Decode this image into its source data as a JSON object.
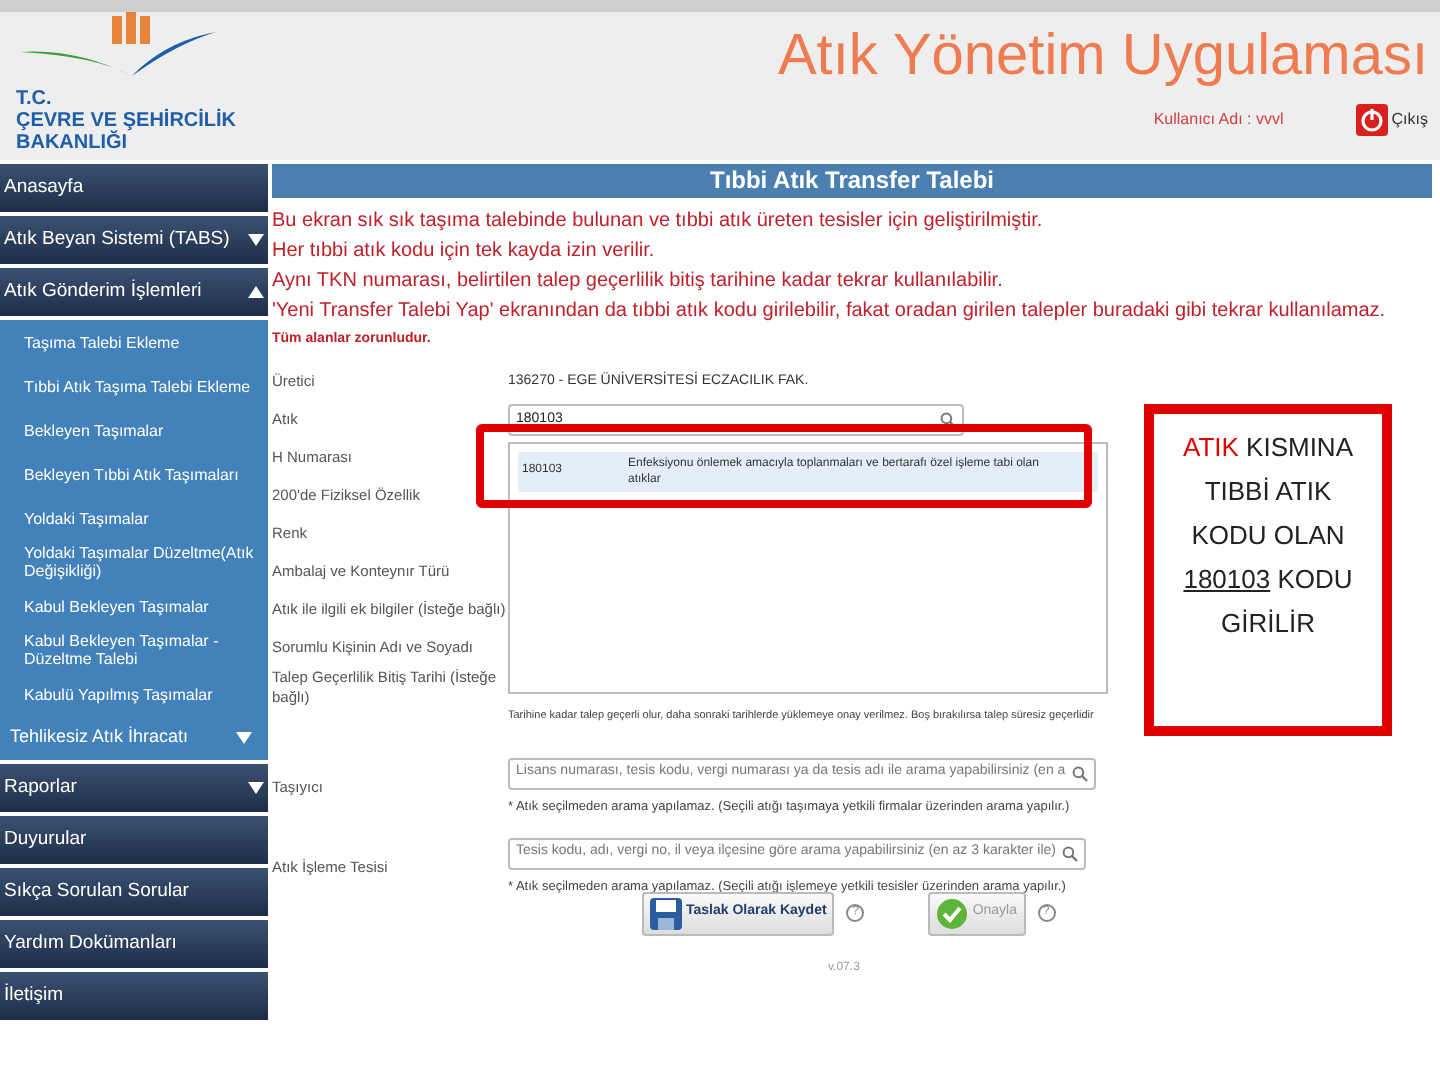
{
  "header": {
    "ministry_lines": [
      "T.C.",
      "ÇEVRE VE ŞEHİRCİLİK",
      "BAKANLIĞI"
    ],
    "app_title": "Atık Yönetim Uygulaması",
    "user_label": "Kullanıcı Adı : vvvl",
    "logout": "Çıkış"
  },
  "sidebar": {
    "items": [
      {
        "label": "Anasayfa",
        "kind": "main"
      },
      {
        "label": "Atık Beyan Sistemi (TABS)",
        "kind": "main",
        "expanded": false
      },
      {
        "label": "Atık Gönderim İşlemleri",
        "kind": "main",
        "expanded": true
      },
      {
        "label": "Taşıma Talebi Ekleme",
        "kind": "sub"
      },
      {
        "label": "Tıbbi Atık Taşıma Talebi Ekleme",
        "kind": "sub"
      },
      {
        "label": "Bekleyen Taşımalar",
        "kind": "sub"
      },
      {
        "label": "Bekleyen Tıbbi Atık Taşımaları",
        "kind": "sub"
      },
      {
        "label": "Yoldaki Taşımalar",
        "kind": "sub"
      },
      {
        "label": "Yoldaki Taşımalar Düzeltme(Atık Değişikliği)",
        "kind": "sub"
      },
      {
        "label": "Kabul Bekleyen Taşımalar",
        "kind": "sub"
      },
      {
        "label": "Kabul Bekleyen Taşımalar - Düzeltme Talebi",
        "kind": "sub"
      },
      {
        "label": "Kabulü Yapılmış Taşımalar",
        "kind": "sub"
      },
      {
        "label": "Tehlikesiz Atık İhracatı",
        "kind": "section",
        "expanded": false
      },
      {
        "label": "Raporlar",
        "kind": "main",
        "expanded": false
      },
      {
        "label": "Duyurular",
        "kind": "main"
      },
      {
        "label": "Sıkça Sorulan Sorular",
        "kind": "main"
      },
      {
        "label": "Yardım Dokümanları",
        "kind": "main"
      },
      {
        "label": "İletişim",
        "kind": "main"
      }
    ]
  },
  "form": {
    "title": "Tıbbi Atık Transfer Talebi",
    "notes": [
      "Bu ekran sık sık taşıma talebinde bulunan ve tıbbi atık üreten tesisler için geliştirilmiştir.",
      "Her tıbbi atık kodu için tek kayda izin verilir.",
      "Aynı TKN numarası, belirtilen talep geçerlilik bitiş tarihine kadar tekrar kullanılabilir.",
      "'Yeni Transfer Talebi Yap' ekranından da tıbbi atık kodu girilebilir, fakat oradan girilen talepler buradaki gibi tekrar kullanılamaz."
    ],
    "required_note": "Tüm alanlar zorunludur.",
    "fields": [
      {
        "label": "Üretici",
        "kind": "text",
        "value": "136270 - EGE ÜNİVERSİTESİ ECZACILIK FAK."
      },
      {
        "label": "Atık",
        "kind": "search",
        "value": "180103"
      },
      {
        "label": "H Numarası",
        "kind": "label"
      },
      {
        "label": "200'de Fiziksel Özellik",
        "kind": "label"
      },
      {
        "label": "Renk",
        "kind": "label"
      },
      {
        "label": "Ambalaj ve Konteynır Türü",
        "kind": "label"
      },
      {
        "label": "Atık ile ilgili ek bilgiler (İsteğe bağlı)",
        "kind": "label"
      },
      {
        "label": "Sorumlu Kişinin Adı ve Soyadı",
        "kind": "label"
      },
      {
        "label": "Talep Geçerlilik Bitiş Tarihi (İsteğe bağlı)",
        "kind": "note",
        "hint": "Tarihine kadar talep geçerli olur, daha sonraki tarihlerde yüklemeye onay verilmez. Boş bırakılırsa talep süresiz geçerlidir"
      },
      {
        "label": "Taşıyıcı",
        "kind": "search",
        "placeholder": "Lisans numarası, tesis kodu, vergi numarası ya da tesis adı ile arama yapabilirsiniz (en a",
        "hint": "* Atık seçilmeden arama yapılamaz. (Seçili atığı taşımaya yetkili firmalar üzerinden arama yapılır.)"
      },
      {
        "label": "Atık İşleme Tesisi",
        "kind": "search",
        "placeholder": "Tesis kodu, adı, vergi no, il veya ilçesine göre arama yapabilirsiniz (en az 3 karakter ile)",
        "hint": "* Atık seçilmeden arama yapılamaz. (Seçili atığı işlemeye yetkili tesisler üzerinden arama yapılır.)"
      }
    ],
    "dropdown": {
      "options": [
        {
          "code": "180103",
          "description": "Enfeksiyonu önlemek amacıyla toplanmaları ve bertarafı özel işleme tabi olan atıklar",
          "selected": true
        }
      ]
    },
    "buttons": [
      {
        "label": "Taslak Olarak Kaydet",
        "kind": "save"
      },
      {
        "label": "Onayla",
        "kind": "approve"
      }
    ],
    "help_mark": "?",
    "version": "v.07.3"
  },
  "callout": {
    "parts": [
      {
        "text": "ATIK",
        "kind": "accent"
      },
      {
        "text": " KISMINA TIBBİ ATIK KODU OLAN ",
        "kind": "plain"
      },
      {
        "text": "180103",
        "kind": "underlined"
      },
      {
        "text": " KODU GİRİLİR",
        "kind": "plain"
      }
    ]
  }
}
